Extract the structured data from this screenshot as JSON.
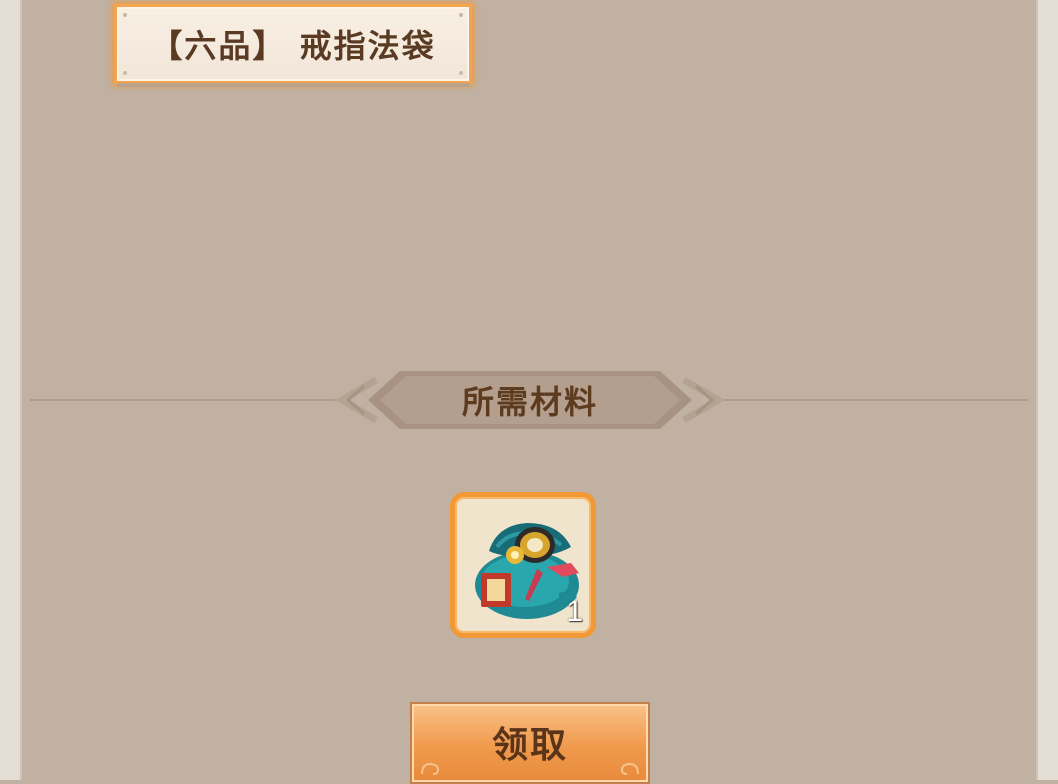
{
  "reward": {
    "title": "【六品】 戒指法袋",
    "accent_color": "#f4a34e"
  },
  "requirements": {
    "section_title": "所需材料",
    "items": [
      {
        "icon": "ring-pouch-icon",
        "count": "1"
      }
    ]
  },
  "actions": {
    "claim_label": "领取"
  }
}
